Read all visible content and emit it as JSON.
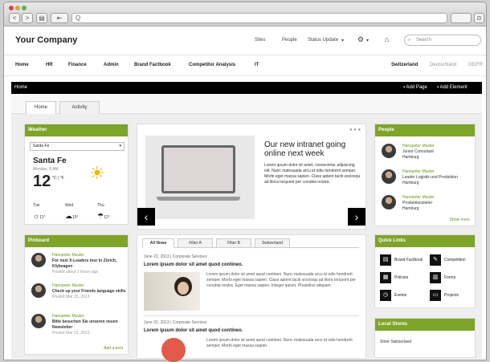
{
  "browser": {
    "url_text": "Q",
    "right_btn_label": "",
    "nav_back": "<",
    "nav_fwd": ">"
  },
  "header": {
    "company": "Your Company",
    "links": [
      "Sites",
      "People",
      "Status Update",
      "Settings"
    ],
    "search_placeholder": "Search"
  },
  "nav": {
    "items": [
      "Home",
      "HR",
      "Finance",
      "Admin",
      "Brand Factbook",
      "Competitor Analysis",
      "IT"
    ],
    "right": [
      "Switzerland",
      "Deutschland",
      "DE/FR"
    ]
  },
  "bar": {
    "title": "Home",
    "actions": [
      "Add Page",
      "Add Element"
    ]
  },
  "tabs": [
    "Home",
    "Activity"
  ],
  "weather": {
    "title": "Weather",
    "city_select": "Santa Fe",
    "city": "Santa Fe",
    "date": "Monday, 8 AM",
    "temp": "12",
    "unit": "°C | °F",
    "forecast": [
      {
        "day": "Tue",
        "temp": "11°"
      },
      {
        "day": "Wed",
        "temp": "10°"
      },
      {
        "day": "Thu",
        "temp": "12°"
      }
    ]
  },
  "hero": {
    "title": "Our new intranet going online next week",
    "body": "Lorem ipsum dolor sit amet, consectetur adipiscing elit. Nunc malesuada arcu id odio hendrerit semper. Morbi eget massa sapien. Class aptent taciti sociosqu ad litora torquent per conubia nostra."
  },
  "people": {
    "title": "People",
    "items": [
      {
        "name": "Hanspeter Muster",
        "role": "Junior Consultant",
        "loc": "Hamburg"
      },
      {
        "name": "Hanspeter Muster",
        "role": "Leader Logistik und Produktion",
        "loc": "Hamburg"
      },
      {
        "name": "Hanspeter Muster",
        "role": "Produktionsleiter",
        "loc": "Hamburg"
      }
    ],
    "more": "Show more"
  },
  "feed": {
    "title": "Pinboard",
    "items": [
      {
        "name": "Hanspeter Muster",
        "text": "For next X-Leaders tour in Zürich, Klybeagen",
        "meta": "Posted about 2 hours ago"
      },
      {
        "name": "Hanspeter Muster",
        "text": "Check up your Friends language skills",
        "meta": "Posted Mar 15, 2013"
      },
      {
        "name": "Hanspeter Muster",
        "text": "Bitte besuchen Sie unseren neuen Newsletter",
        "meta": "Posted Mar 15, 2013"
      }
    ],
    "more": "Add a post"
  },
  "news": {
    "tabs": [
      "All News",
      "Filter A",
      "Filter B",
      "Switzerland"
    ],
    "items": [
      {
        "meta": "June 22, 2013 | Corporate Services",
        "title": "Lorem ipsum dolor sit amet quod contineo.",
        "body": "Lorem ipsum dolor sit amet quod contineo. Nunc malesuada arcu id odio hendrerit semper. Morbi eget massa sapien. Class aptent taciti sociosqu ad litora torquent per conubia nostra. Eget massa sapien. Integer ipsum, Phasellus aliquam."
      },
      {
        "meta": "June 22, 2013 | Corporate Services",
        "title": "Lorem ipsum dolor sit amet quod contineo.",
        "body": "Lorem ipsum dolor sit amet quod contineo. Nunc malesuada arcu id odio hendrerit semper. Morbi eget massa sapien."
      }
    ]
  },
  "quick": {
    "title": "Quick Links",
    "items": [
      "Brand Factbook",
      "Competition",
      "Policies",
      "Forms",
      "Events",
      "Projects"
    ]
  },
  "local": {
    "title": "Local Stores",
    "text": "Store Switzerland"
  },
  "colors": {
    "accent": "#7ea42a"
  }
}
